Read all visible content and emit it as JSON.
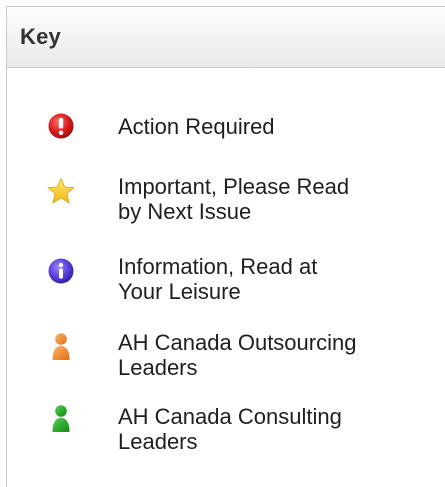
{
  "panel": {
    "title": "Key"
  },
  "key_items": [
    {
      "icon": "exclamation-icon",
      "color": "#e01b1b",
      "label": "Action Required"
    },
    {
      "icon": "star-icon",
      "color": "#f7c81e",
      "label": "Important, Please Read\nby Next Issue"
    },
    {
      "icon": "info-icon",
      "color": "#5b3ee0",
      "label": "Information, Read at\nYour Leisure"
    },
    {
      "icon": "person-icon",
      "color": "#f28a2e",
      "label": "AH Canada Outsourcing\nLeaders"
    },
    {
      "icon": "person-icon",
      "color": "#1aa01a",
      "label": "AH Canada Consulting\nLeaders"
    }
  ]
}
